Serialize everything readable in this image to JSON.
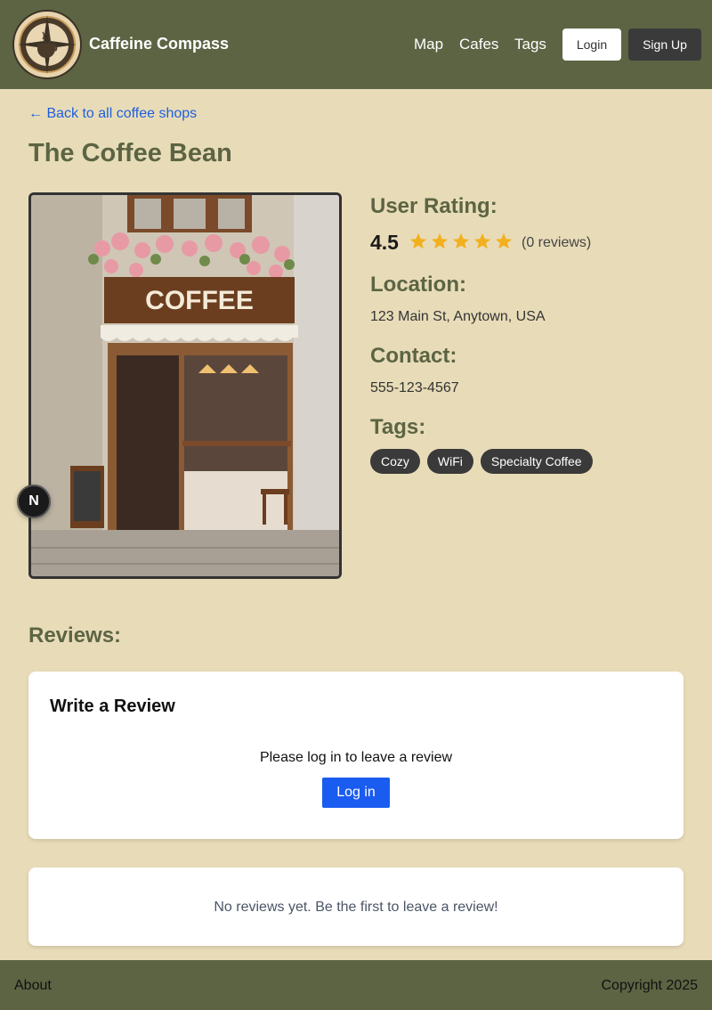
{
  "header": {
    "brand": "Caffeine Compass",
    "nav": [
      "Map",
      "Cafes",
      "Tags"
    ],
    "login_label": "Login",
    "signup_label": "Sign Up"
  },
  "main": {
    "back_link": "← Back to all coffee shops",
    "title": "The Coffee Bean",
    "photo_sign_text": "COFFEE",
    "rating_heading": "User Rating:",
    "rating_value": "4.5",
    "rating_stars": 5,
    "reviews_count": "(0 reviews)",
    "location_heading": "Location:",
    "location": "123 Main St, Anytown, USA",
    "contact_heading": "Contact:",
    "contact": "555-123-4567",
    "tags_heading": "Tags:",
    "tags": [
      "Cozy",
      "WiFi",
      "Specialty Coffee"
    ]
  },
  "floating_badge": "N",
  "reviews": {
    "heading": "Reviews:",
    "write_title": "Write a Review",
    "prompt": "Please log in to leave a review",
    "login_button": "Log in",
    "empty_message": "No reviews yet. Be the first to leave a review!"
  },
  "footer": {
    "about": "About",
    "copyright": "Copyright 2025"
  },
  "colors": {
    "background": "#e8dcb8",
    "header": "#5c6443",
    "accent_heading": "#5c6443",
    "link": "#1f5fe0",
    "star": "#f2b01e",
    "primary_button": "#1a5cf0",
    "tag": "#3a3a3a"
  },
  "icons": [
    "compass-logo-icon",
    "star-icon",
    "next-badge-icon"
  ]
}
